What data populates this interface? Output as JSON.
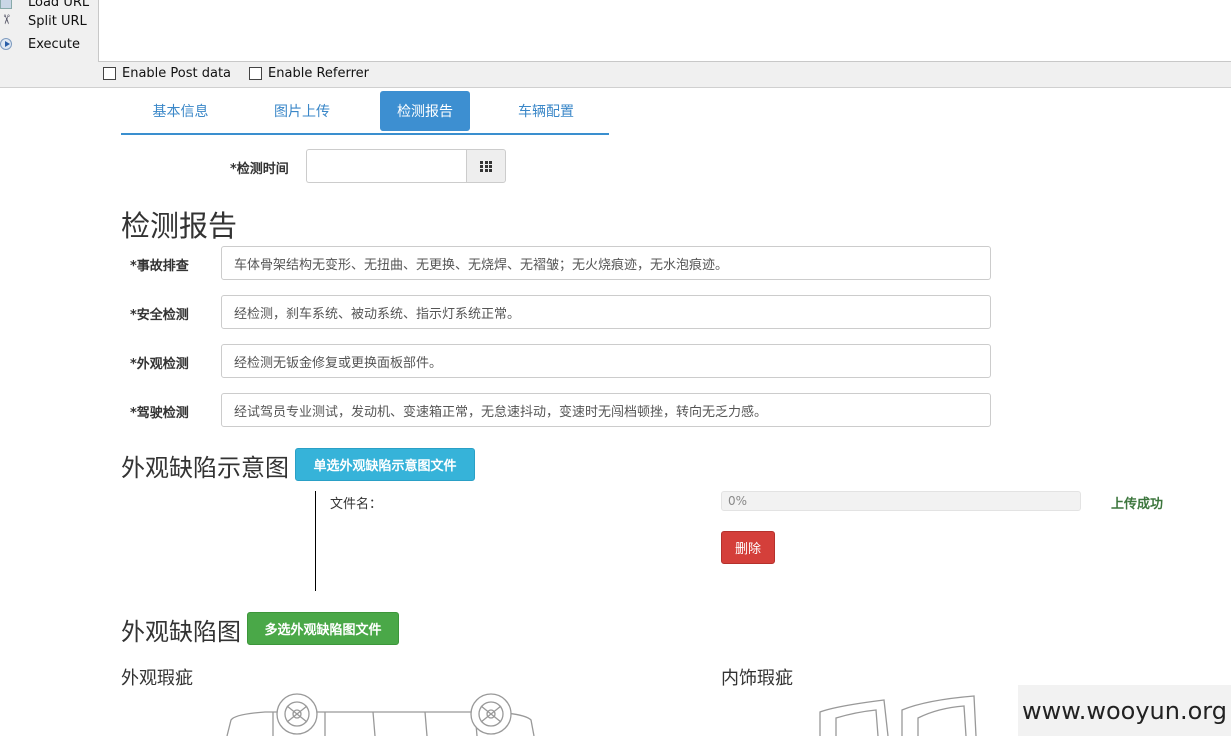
{
  "toolbar": {
    "load_url": "Load URL",
    "split_url": "Split URL",
    "execute": "Execute",
    "enable_post": "Enable Post data",
    "enable_referrer": "Enable Referrer"
  },
  "tabs": [
    {
      "label": "基本信息",
      "active": false
    },
    {
      "label": "图片上传",
      "active": false
    },
    {
      "label": "检测报告",
      "active": true
    },
    {
      "label": "车辆配置",
      "active": false
    }
  ],
  "inspection_time": {
    "label": "*检测时间",
    "value": ""
  },
  "report": {
    "title": "检测报告",
    "fields": [
      {
        "label": "*事故排查",
        "value": "车体骨架结构无变形、无扭曲、无更换、无烧焊、无褶皱；无火烧痕迹，无水泡痕迹。"
      },
      {
        "label": "*安全检测",
        "value": "经检测，刹车系统、被动系统、指示灯系统正常。"
      },
      {
        "label": "*外观检测",
        "value": "经检测无钣金修复或更换面板部件。"
      },
      {
        "label": "*驾驶检测",
        "value": "经试驾员专业测试，发动机、变速箱正常，无怠速抖动，变速时无闯档顿挫，转向无乏力感。"
      }
    ]
  },
  "defect_diagram": {
    "title": "外观缺陷示意图",
    "button": "单选外观缺陷示意图文件",
    "file_label": "文件名：",
    "progress": {
      "value": 0,
      "text": "0%"
    },
    "status": "上传成功",
    "delete": "删除"
  },
  "defect_images": {
    "title": "外观缺陷图",
    "button": "多选外观缺陷图文件",
    "exterior": "外观瑕疵",
    "interior": "内饰瑕疵"
  },
  "watermark": "www.wooyun.org",
  "colors": {
    "accent": "#3d8fd1",
    "info": "#36b3d9",
    "success": "#4aa848",
    "danger": "#d43f3a",
    "status_ok": "#3c763d"
  }
}
